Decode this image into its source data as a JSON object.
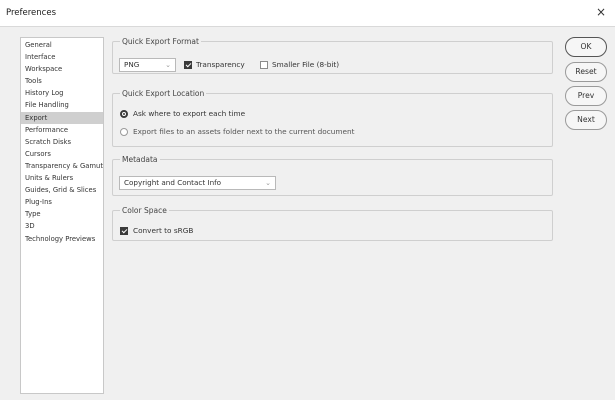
{
  "window": {
    "title": "Preferences",
    "close_glyph": "×"
  },
  "sidebar": {
    "items": [
      "General",
      "Interface",
      "Workspace",
      "Tools",
      "History Log",
      "File Handling",
      "Export",
      "Performance",
      "Scratch Disks",
      "Cursors",
      "Transparency & Gamut",
      "Units & Rulers",
      "Guides, Grid & Slices",
      "Plug-Ins",
      "Type",
      "3D",
      "Technology Previews"
    ],
    "selected": "Export"
  },
  "quick_export_format": {
    "legend": "Quick Export Format",
    "format_value": "PNG",
    "transparency_label": "Transparency",
    "transparency_checked": true,
    "smaller_file_label": "Smaller File (8-bit)",
    "smaller_file_checked": false
  },
  "quick_export_location": {
    "legend": "Quick Export Location",
    "option_ask": "Ask where to export each time",
    "option_assets": "Export files to an assets folder next to the current document",
    "selected": "ask"
  },
  "metadata": {
    "legend": "Metadata",
    "value": "Copyright and Contact Info"
  },
  "color_space": {
    "legend": "Color Space",
    "convert_label": "Convert to sRGB",
    "convert_checked": true
  },
  "buttons": {
    "ok": "OK",
    "reset": "Reset",
    "prev": "Prev",
    "next": "Next"
  },
  "icons": {
    "dropdown": "chevron-down-icon",
    "close": "close-icon"
  }
}
